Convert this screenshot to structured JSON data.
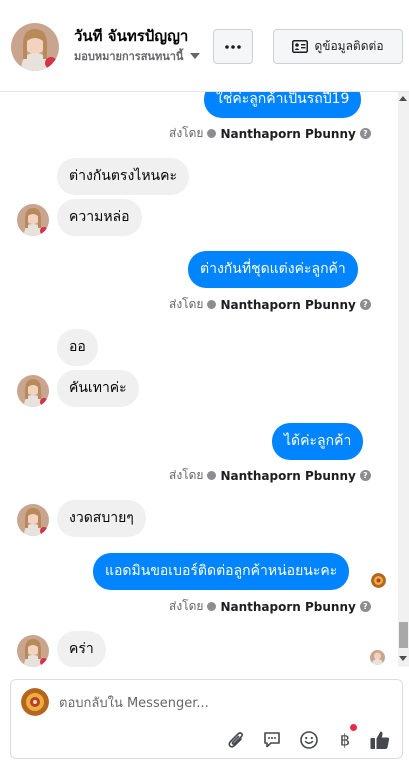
{
  "header": {
    "name": "วันที จันทรปัญญา",
    "subname": "มอบหมายการสนทนานี้",
    "contact_label": "ดูข้อมูลติดต่อ"
  },
  "messages": {
    "m1": "ใช่ค่ะลูกค้าเป็นรถปี19",
    "m2": "ต่างกันตรงไหนคะ",
    "m3": "ความหล่อ",
    "m4": "ต่างกันที่ชุดแต่งค่ะลูกค้า",
    "m5": "ออ",
    "m6": "คันเทาค่ะ",
    "m7": "ได้ค่ะลูกค้า",
    "m8": "งวดสบายๆ",
    "m9": "แอดมินขอเบอร์ติดต่อลูกค้าหน่อยนะคะ",
    "m10": "คร่า"
  },
  "sent_by": {
    "label": "ส่งโดย",
    "name": "Nanthaporn Pbunny"
  },
  "composer": {
    "placeholder": "ตอบกลับใน Messenger..."
  },
  "colors": {
    "outgoing": "#0084ff",
    "incoming": "#f0f0f0",
    "notification_dot": "#f02849"
  },
  "icons": [
    "more-icon",
    "contact-card-icon",
    "help-icon",
    "paperclip-icon",
    "saved-reply-icon",
    "emoji-icon",
    "baht-icon",
    "like-icon"
  ]
}
